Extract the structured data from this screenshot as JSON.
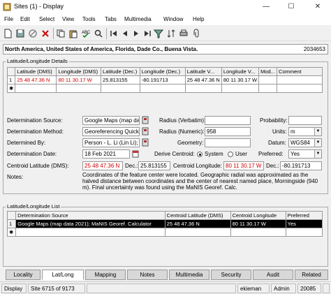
{
  "window": {
    "title": "Sites (1) - Display",
    "min": "—",
    "max": "☐",
    "close": "✕"
  },
  "menu": [
    "File",
    "Edit",
    "Select",
    "View",
    "Tools",
    "Tabs",
    "Multimedia",
    "Window",
    "Help"
  ],
  "toolbar_icons": [
    "new-record-icon",
    "save-icon",
    "cancel-icon",
    "delete-icon",
    "copy-icon",
    "paste-icon",
    "spellcheck-icon",
    "find-icon",
    "first-record-icon",
    "prev-record-icon",
    "next-record-icon",
    "last-record-icon",
    "filter-icon",
    "sort-icon",
    "print-icon",
    "attach-icon"
  ],
  "path": {
    "text": "North America, United States of America, Florida, Dade Co., Buena Vista.",
    "id": "2034653"
  },
  "latlong_details": {
    "label": "Latitude/Longitude Details",
    "columns": [
      "",
      "Latitude (DMS)",
      "Longitude (DMS)",
      "Latitude (Dec.)",
      "Longitude (Dec.)",
      "Latitude V...",
      "Longitude V...",
      "Mod...",
      "Comment"
    ],
    "rows": [
      {
        "marker": "1",
        "lat_dms": "25 48 47.36 N",
        "lon_dms": "80 11 30.17 W",
        "lat_dec": "25.813155",
        "lon_dec": "-80.191713",
        "lat_v": "25 48 47.36 N",
        "lon_v": "80 11 30.17 W",
        "mod": "",
        "comment": ""
      }
    ],
    "new_marker": "✱"
  },
  "form": {
    "det_source_label": "Determination Source:",
    "det_source_value": "Google Maps (map dat",
    "det_method_label": "Determination Method:",
    "det_method_value": "Georeferencing Quick",
    "determined_by_label": "Determined By:",
    "determined_by_value": "Person - L. Li (Lin Li);",
    "det_date_label": "Determination Date:",
    "det_date_value": "18 Feb 2021",
    "centroid_lat_label": "Centroid Latitude (DMS):",
    "centroid_lat_value": "25 48 47.36 N",
    "dec_label_1": "Dec.:",
    "dec_value_1": "25.813155",
    "centroid_lon_label": "Centroid Longitude:",
    "centroid_lon_value": "80 11 30.17 W",
    "dec_label_2": "Dec.:",
    "dec_value_2": "-80.191713",
    "notes_label": "Notes:",
    "notes_value": "Coordinates of the feature center were located. Geographic radial was approximated as the halved distance between coordinates and the center of nearest named place, Morningside (940 m). Final uncertainty was found using the MaNIS Georef. Calc.",
    "radius_verbatim_label": "Radius (Verbatim):",
    "radius_verbatim_value": "",
    "radius_numeric_label": "Radius (Numeric):",
    "radius_numeric_value": "958",
    "geometry_label": "Geometry:",
    "geometry_value": "",
    "derive_centroid_label": "Derive Centroid:",
    "radio_system": "System",
    "radio_user": "User",
    "probability_label": "Probability:",
    "probability_value": "",
    "units_label": "Units:",
    "units_value": "m",
    "datum_label": "Datum:",
    "datum_value": "WGS84",
    "preferred_label": "Preferred:",
    "preferred_value": "Yes"
  },
  "latlong_list": {
    "label": "Latitude/Longitude List",
    "columns": [
      "",
      "Determination Source",
      "Centroid Latitude (DMS)",
      "Centroid Longitude",
      "Preferred"
    ],
    "rows": [
      {
        "marker": "1",
        "source": "Google Maps (map data 2021); MaNIS Georef. Calculator",
        "lat": "25 48 47.36 N",
        "lon": "80 11 30.17 W",
        "preferred": "Yes"
      }
    ],
    "new_marker": "✱"
  },
  "tabs": [
    "Locality",
    "Lat/Long",
    "Mapping",
    "Notes",
    "Multimedia",
    "Security",
    "Audit",
    "Related"
  ],
  "active_tab": "Lat/Long",
  "status": {
    "mode": "Display",
    "record": "Site 6715 of 9173",
    "user": "ekieman",
    "role": "Admin",
    "count": "20085"
  }
}
